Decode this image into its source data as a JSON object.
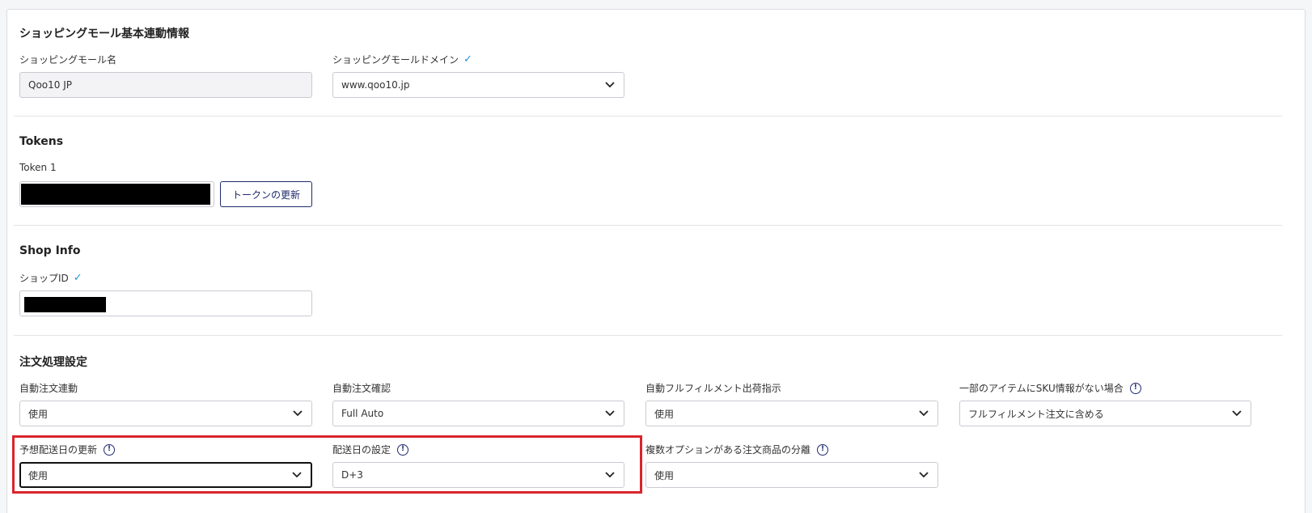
{
  "mall_basic": {
    "title": "ショッピングモール基本連動情報",
    "mall_name_label": "ショッピングモール名",
    "mall_name_value": "Qoo10 JP",
    "mall_domain_label": "ショッピングモールドメイン",
    "mall_domain_value": "www.qoo10.jp",
    "check_icon": "✓"
  },
  "tokens": {
    "title": "Tokens",
    "token1_label": "Token 1",
    "refresh_button": "トークンの更新"
  },
  "shop_info": {
    "title": "Shop Info",
    "shop_id_label": "ショップID",
    "check_icon": "✓"
  },
  "order_settings": {
    "title": "注文処理設定",
    "fields": [
      {
        "label": "自動注文連動",
        "value": "使用"
      },
      {
        "label": "自動注文確認",
        "value": "Full Auto"
      },
      {
        "label": "自動フルフィルメント出荷指示",
        "value": "使用"
      },
      {
        "label": "一部のアイテムにSKU情報がない場合",
        "value": "フルフィルメント注文に含める"
      },
      {
        "label": "予想配送日の更新",
        "value": "使用"
      },
      {
        "label": "配送日の設定",
        "value": "D+3"
      },
      {
        "label": "複数オプションがある注文商品の分離",
        "value": "使用"
      }
    ],
    "info_icon": "!"
  },
  "colors": {
    "accent": "#1e2a6e",
    "check": "#1d95d6",
    "highlight": "#d9252b"
  },
  "icons": [
    "check-icon",
    "chevron-down-icon",
    "info-icon"
  ]
}
